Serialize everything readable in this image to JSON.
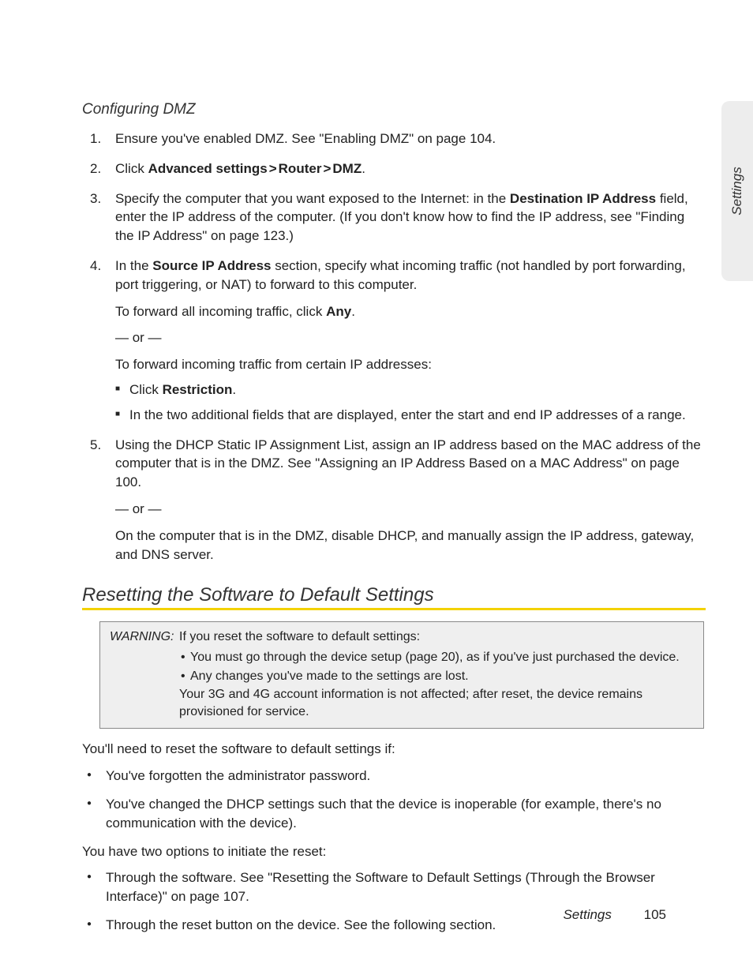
{
  "sideTab": "Settings",
  "footer": {
    "section": "Settings",
    "page": "105"
  },
  "s1": {
    "heading": "Configuring DMZ",
    "steps": {
      "n1": "1.",
      "t1": "Ensure you've enabled DMZ. See \"Enabling DMZ\" on page 104.",
      "n2": "2.",
      "t2a": "Click ",
      "t2b": "Advanced settings",
      "t2c": "Router",
      "t2d": "DMZ",
      "t2e": ".",
      "n3": "3.",
      "t3a": "Specify the computer that you want exposed to the Internet: in the ",
      "t3b": "Destination IP Address",
      "t3c": " field, enter the IP address of the computer. (If you don't know how to find the IP address, see \"Finding the IP Address\" on page 123.)",
      "n4": "4.",
      "t4a": "In the ",
      "t4b": "Source IP Address",
      "t4c": " section, specify what incoming traffic (not handled by port forwarding, port triggering, or NAT) to forward to this computer.",
      "t4p1a": "To forward all incoming traffic, click ",
      "t4p1b": "Any",
      "t4p1c": ".",
      "t4or": "— or —",
      "t4p2": "To forward incoming traffic from certain IP addresses:",
      "t4b1a": "Click ",
      "t4b1b": "Restriction",
      "t4b1c": ".",
      "t4b2": "In the two additional fields that are displayed, enter the start and end IP addresses of a range.",
      "n5": "5.",
      "t5": "Using the DHCP Static IP Assignment List, assign an IP address based on the MAC address of the computer that is in the DMZ. See \"Assigning an IP Address Based on a MAC Address\" on page 100.",
      "t5or": "— or —",
      "t5p2": "On the computer that is in the DMZ, disable DHCP, and manually assign the IP address, gateway, and DNS server."
    }
  },
  "s2": {
    "heading": "Resetting the Software to Default Settings",
    "warn": {
      "label": "WARNING:",
      "intro": "If you reset the software to default settings:",
      "b1": "You must go through the device setup (page 20), as if you've just purchased the device.",
      "b2": "Any changes you've made to the settings are lost.",
      "note": "Your 3G and 4G account information is not affected; after reset, the device remains provisioned for service."
    },
    "p1": "You'll need to reset the software to default settings if:",
    "b1": "You've forgotten the administrator password.",
    "b2": "You've changed the DHCP settings such that the device is inoperable (for example, there's no communication with the device).",
    "p2": "You have two options to initiate the reset:",
    "b3": "Through the software. See \"Resetting the Software to Default Settings (Through the Browser Interface)\" on page 107.",
    "b4": "Through the reset button on the device. See the following section."
  }
}
